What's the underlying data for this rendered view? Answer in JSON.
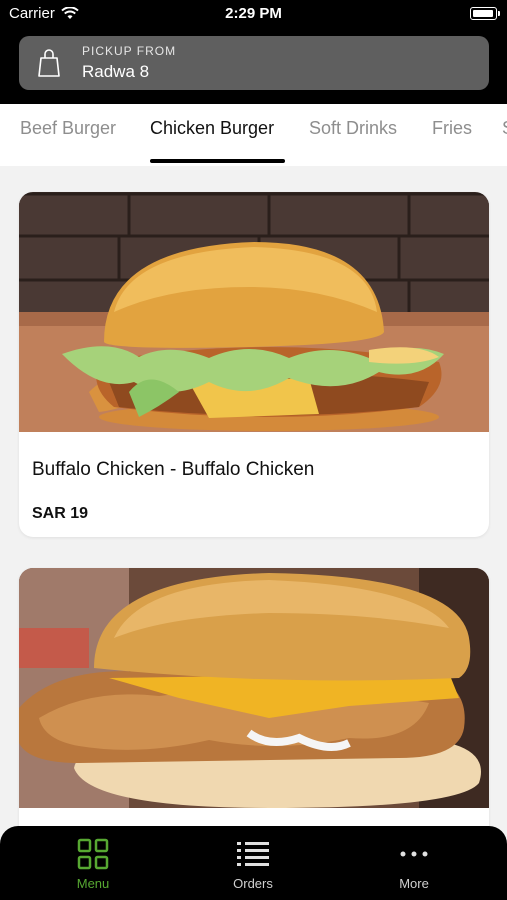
{
  "status_bar": {
    "carrier": "Carrier",
    "time": "2:29 PM"
  },
  "pickup": {
    "label": "PICKUP FROM",
    "location": "Radwa 8"
  },
  "tabs": [
    {
      "label": "Beef Burger"
    },
    {
      "label": "Chicken Burger",
      "active": true
    },
    {
      "label": "Soft Drinks"
    },
    {
      "label": "Fries"
    },
    {
      "label": "S"
    }
  ],
  "products": [
    {
      "name": "Buffalo Chicken - Buffalo Chicken",
      "price": "SAR 19"
    },
    {
      "name": "",
      "price": ""
    }
  ],
  "bottom_nav": [
    {
      "label": "Menu",
      "icon": "grid-icon",
      "active": true
    },
    {
      "label": "Orders",
      "icon": "list-icon"
    },
    {
      "label": "More",
      "icon": "dots-icon"
    }
  ],
  "colors": {
    "accent": "#57a832",
    "header": "#000000",
    "pickup_bg": "#5f5f5f"
  }
}
